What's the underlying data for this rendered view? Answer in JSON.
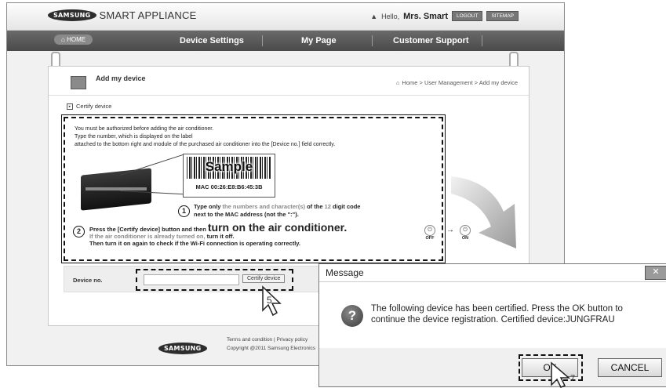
{
  "header": {
    "brand_logo": "SAMSUNG",
    "app_name": "SMART APPLIANCE",
    "greeting": "Hello,",
    "user_name": "Mrs. Smart",
    "logout_label": "LOGOUT",
    "sitemap_label": "SITEMAP"
  },
  "nav": {
    "home_label": "HOME",
    "items": [
      "Device Settings",
      "My Page",
      "Customer Support"
    ]
  },
  "page": {
    "title": "Add my device",
    "breadcrumb": "Home > User Management > Add my device",
    "section_label": "Certify device"
  },
  "instructions": {
    "line1": "You must be authorized before adding the air conditioner.",
    "line2": "Type the number, which is displayed on the label",
    "line3": "attached to the bottom right and module of the purchased air conditioner into the [Device no.] field correctly.",
    "sample_word": "Sample",
    "mac_label": "MAC 00:26:E8:B6:45:3B",
    "step1_number": "1",
    "step1_a": "Type only",
    "step1_b": "the numbers and character(s)",
    "step1_c": "of the",
    "step1_d": "12",
    "step1_e": "digit code",
    "step1_line2": "next to the MAC address (not the \":\").",
    "step2_number": "2",
    "step2_a": "Press the [Certify device] button and then",
    "step2_big": "turn on the air conditioner.",
    "step2_line2_a": "If the air conditioner is already turned on,",
    "step2_line2_b": "turn it off.",
    "step2_line3": "Then turn it on again to check if the Wi-Fi connection is operating correctly.",
    "off_label": "OFF",
    "on_label": "ON",
    "arrow": "→"
  },
  "device_form": {
    "label": "Device no.",
    "value": "",
    "button_label": "Certify device"
  },
  "footer": {
    "logo": "SAMSUNG",
    "links": "Terms and condition | Privacy policy",
    "copyright": "Copyright @2011 Samsung Electronics"
  },
  "dialog": {
    "title": "Message",
    "close_label": "✕",
    "message": "The following device has been certified. Press the OK button to continue the device registration. Certified device:JUNGFRAU",
    "ok_label": "OK",
    "cancel_label": "CANCEL"
  },
  "callouts": {
    "step5": "5",
    "step7": "7"
  },
  "colors": {
    "navbar": "#555555",
    "dialog_bg": "#f0f0f0"
  }
}
